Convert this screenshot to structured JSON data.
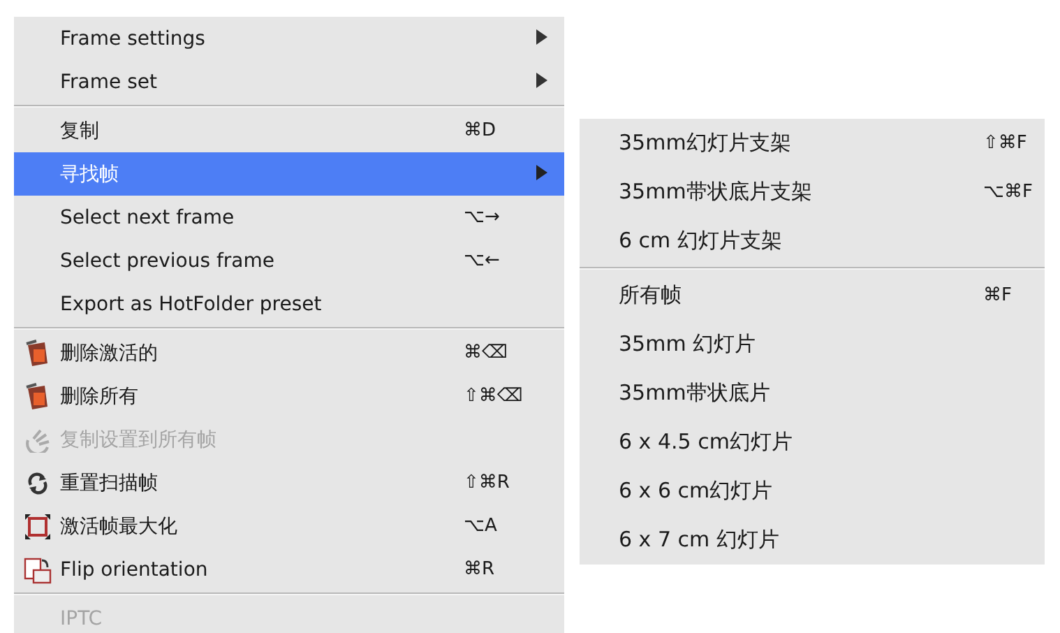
{
  "main_menu": {
    "items": [
      {
        "kind": "item",
        "label": "Frame settings",
        "submenu": true,
        "selected": false,
        "disabled": false
      },
      {
        "kind": "item",
        "label": "Frame set",
        "submenu": true,
        "selected": false,
        "disabled": false
      },
      {
        "kind": "separator"
      },
      {
        "kind": "item",
        "label": "复制",
        "shortcut": "⌘D",
        "selected": false,
        "disabled": false
      },
      {
        "kind": "item",
        "label": "寻找帧",
        "submenu": true,
        "selected": true,
        "disabled": false
      },
      {
        "kind": "item",
        "label": "Select next frame",
        "shortcut": "⌥→",
        "selected": false,
        "disabled": false
      },
      {
        "kind": "item",
        "label": "Select previous frame",
        "shortcut": "⌥←",
        "selected": false,
        "disabled": false
      },
      {
        "kind": "item",
        "label": "Export as HotFolder preset",
        "selected": false,
        "disabled": false
      },
      {
        "kind": "separator"
      },
      {
        "kind": "trash",
        "label": "删除激活的",
        "shortcut": "⌘⌫",
        "selected": false,
        "disabled": false
      },
      {
        "kind": "trash",
        "label": "删除所有",
        "shortcut": "⇧⌘⌫",
        "selected": false,
        "disabled": false
      },
      {
        "kind": "swirl",
        "label": "复制设置到所有帧",
        "selected": false,
        "disabled": true
      },
      {
        "kind": "refresh",
        "label": "重置扫描帧",
        "shortcut": "⇧⌘R",
        "selected": false,
        "disabled": false
      },
      {
        "kind": "maximize",
        "label": "激活帧最大化",
        "shortcut": "⌥A",
        "selected": false,
        "disabled": false
      },
      {
        "kind": "flip",
        "label": "Flip orientation",
        "shortcut": "⌘R",
        "selected": false,
        "disabled": false
      },
      {
        "kind": "separator"
      },
      {
        "kind": "item",
        "label": "IPTC",
        "selected": false,
        "disabled": true
      }
    ]
  },
  "submenu": {
    "items": [
      {
        "kind": "item",
        "label": "35mm幻灯片支架",
        "shortcut": "⇧⌘F"
      },
      {
        "kind": "item",
        "label": "35mm带状底片支架",
        "shortcut": "⌥⌘F"
      },
      {
        "kind": "item",
        "label": "6 cm 幻灯片支架"
      },
      {
        "kind": "separator"
      },
      {
        "kind": "item",
        "label": "所有帧",
        "shortcut": "⌘F"
      },
      {
        "kind": "item",
        "label": "35mm 幻灯片"
      },
      {
        "kind": "item",
        "label": "35mm带状底片"
      },
      {
        "kind": "item",
        "label": "6 x 4.5 cm幻灯片"
      },
      {
        "kind": "item",
        "label": "6 x 6 cm幻灯片"
      },
      {
        "kind": "item",
        "label": "6 x 7 cm 幻灯片"
      }
    ]
  }
}
